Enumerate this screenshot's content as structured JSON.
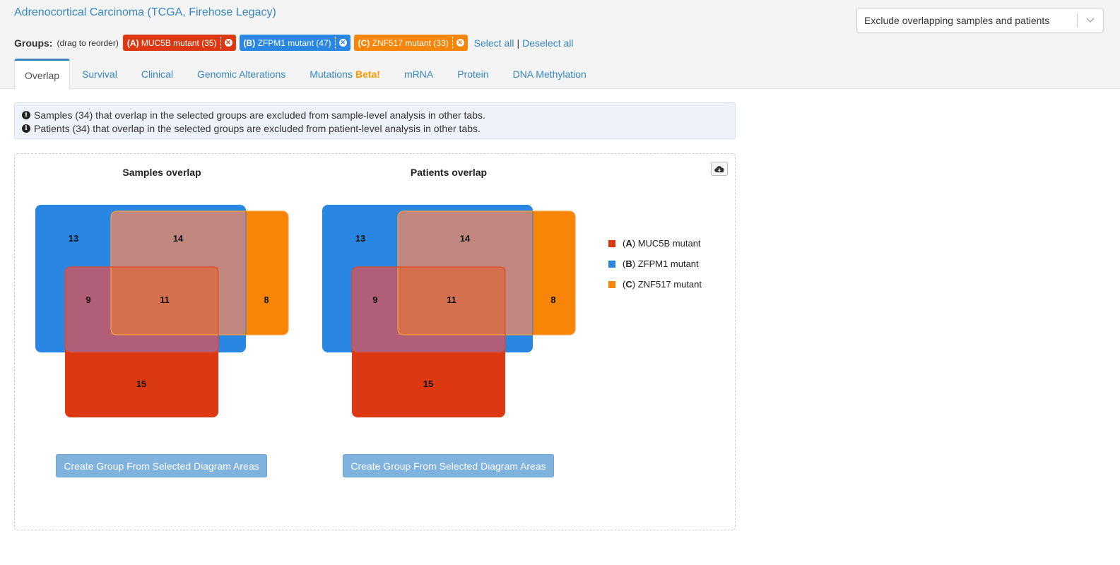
{
  "study_title": "Adrenocortical Carcinoma (TCGA, Firehose Legacy)",
  "groups": {
    "label": "Groups:",
    "hint": "(drag to reorder)",
    "chips": [
      {
        "letter": "(A)",
        "name": "MUC5B mutant (35)",
        "color": "#dc3912"
      },
      {
        "letter": "(B)",
        "name": "ZFPM1 mutant (47)",
        "color": "#2986e2"
      },
      {
        "letter": "(C)",
        "name": "ZNF517 mutant (33)",
        "color": "#f88508"
      }
    ],
    "select_all": "Select all",
    "separator": "|",
    "deselect_all": "Deselect all"
  },
  "exclude_select": {
    "value": "Exclude overlapping samples and patients",
    "caret_icon": "chevron-down-icon"
  },
  "tabs": [
    {
      "label": "Overlap",
      "active": true
    },
    {
      "label": "Survival"
    },
    {
      "label": "Clinical"
    },
    {
      "label": "Genomic Alterations"
    },
    {
      "label": "Mutations",
      "badge": "Beta!"
    },
    {
      "label": "mRNA"
    },
    {
      "label": "Protein"
    },
    {
      "label": "DNA Methylation"
    }
  ],
  "info": {
    "line1": "Samples (34) that overlap in the selected groups are excluded from sample-level analysis in other tabs.",
    "line2": "Patients (34) that overlap in the selected groups are excluded from patient-level analysis in other tabs.",
    "icon": "info-circle-icon"
  },
  "download_icon": "cloud-download-icon",
  "venns": [
    {
      "title": "Samples overlap",
      "regions": {
        "B_only": "13",
        "B_C": "14",
        "A_B": "9",
        "A_B_C": "11",
        "C_only": "8",
        "A_only": "15"
      },
      "button": "Create Group From Selected Diagram Areas"
    },
    {
      "title": "Patients overlap",
      "regions": {
        "B_only": "13",
        "B_C": "14",
        "A_B": "9",
        "A_B_C": "11",
        "C_only": "8",
        "A_only": "15"
      },
      "button": "Create Group From Selected Diagram Areas"
    }
  ],
  "legend": [
    {
      "letter": "A",
      "name": "MUC5B mutant",
      "color": "#dc3912"
    },
    {
      "letter": "B",
      "name": "ZFPM1 mutant",
      "color": "#2986e2"
    },
    {
      "letter": "C",
      "name": "ZNF517 mutant",
      "color": "#f88508"
    }
  ]
}
